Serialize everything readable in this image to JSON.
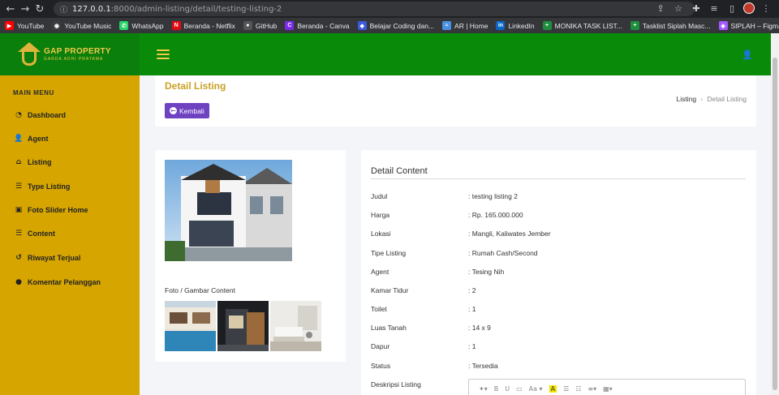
{
  "browser": {
    "url_host": "127.0.0.1",
    "url_path": ":8000/admin-listing/detail/testing-listing-2",
    "bookmarks": [
      {
        "label": "YouTube",
        "color": "#ff0000",
        "glyph": "▶"
      },
      {
        "label": "YouTube Music",
        "color": "#3c3c3c",
        "glyph": "◉"
      },
      {
        "label": "WhatsApp",
        "color": "#25d366",
        "glyph": "✆"
      },
      {
        "label": "Beranda - Netflix",
        "color": "#e50914",
        "glyph": "N"
      },
      {
        "label": "GitHub",
        "color": "#555555",
        "glyph": "●"
      },
      {
        "label": "Beranda - Canva",
        "color": "#7d2ae8",
        "glyph": "C"
      },
      {
        "label": "Belajar Coding dan...",
        "color": "#3a5ad9",
        "glyph": "◆"
      },
      {
        "label": "AR | Home",
        "color": "#4a90e2",
        "glyph": "≈"
      },
      {
        "label": "LinkedIn",
        "color": "#0a66c2",
        "glyph": "in"
      },
      {
        "label": "MONIKA TASK LIST...",
        "color": "#1e8e3e",
        "glyph": "+"
      },
      {
        "label": "Tasklist Siplah Masc...",
        "color": "#1e8e3e",
        "glyph": "+"
      },
      {
        "label": "SIPLAH – Figma",
        "color": "#a259ff",
        "glyph": "◈"
      }
    ]
  },
  "header": {
    "logo_title": "GAP PROPERTY",
    "logo_subtitle": "GARDA ADHI PRATAMA"
  },
  "sidebar": {
    "menu_title": "MAIN MENU",
    "items": [
      {
        "label": "Dashboard",
        "icon": "dashboard-icon",
        "glyph": "◔"
      },
      {
        "label": "Agent",
        "icon": "user-icon",
        "glyph": "👤"
      },
      {
        "label": "Listing",
        "icon": "home-icon",
        "glyph": "⌂"
      },
      {
        "label": "Type Listing",
        "icon": "list-icon",
        "glyph": "☰"
      },
      {
        "label": "Foto Slider Home",
        "icon": "image-icon",
        "glyph": "▣"
      },
      {
        "label": "Content",
        "icon": "list-icon",
        "glyph": "☰"
      },
      {
        "label": "Riwayat Terjual",
        "icon": "history-icon",
        "glyph": "↺"
      },
      {
        "label": "Komentar Pelanggan",
        "icon": "comment-icon",
        "glyph": "●"
      }
    ]
  },
  "page": {
    "title": "Detail Listing",
    "back_label": "Kembali",
    "breadcrumb_parent": "Listing",
    "breadcrumb_current": "Detail Listing"
  },
  "image_card": {
    "caption": "Foto / Gambar Content"
  },
  "detail": {
    "heading": "Detail Content",
    "rows": [
      {
        "label": "Judul",
        "value": ": testing listing 2"
      },
      {
        "label": "Harga",
        "value": ": Rp. 165.000.000"
      },
      {
        "label": "Lokasi",
        "value": ": Mangli, Kaliwates Jember"
      },
      {
        "label": "Tipe Listing",
        "value": ": Rumah Cash/Second"
      },
      {
        "label": "Agent",
        "value": ": Tesing Nih"
      },
      {
        "label": "Kamar Tidur",
        "value": ": 2"
      },
      {
        "label": "Toilet",
        "value": ": 1"
      },
      {
        "label": "Luas Tanah",
        "value": ": 14 x 9"
      },
      {
        "label": "Dapur",
        "value": ": 1"
      },
      {
        "label": "Status",
        "value": ": Tersedia"
      },
      {
        "label": "Deskripsi Listing",
        "value": ""
      }
    ]
  },
  "colors": {
    "header_green": "#098a09",
    "sidebar_gold": "#d6a500",
    "title_gold": "#c9a227",
    "button_purple": "#6f42c1"
  }
}
